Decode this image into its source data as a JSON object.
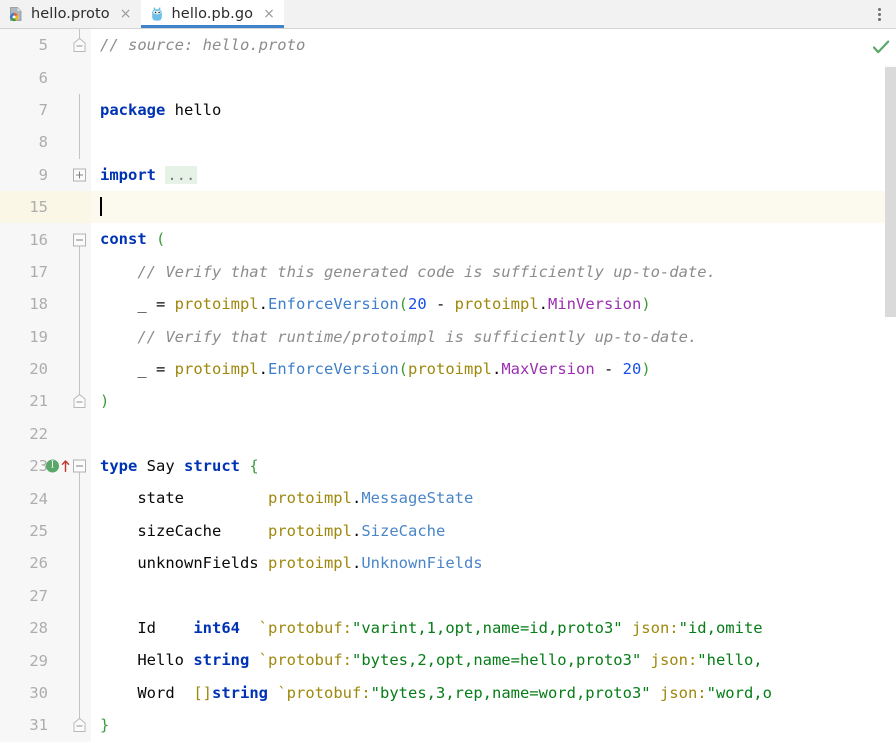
{
  "window": {
    "kebab_menu_label": "More options"
  },
  "tabs": [
    {
      "label": "hello.proto",
      "icon": "protobuf-file-icon",
      "close": "×",
      "active": false
    },
    {
      "label": "hello.pb.go",
      "icon": "go-file-icon",
      "close": "×",
      "active": true
    }
  ],
  "editor": {
    "language": "Go",
    "current_line": 15,
    "status_icon": "inspection-ok-checkmark",
    "colors": {
      "keyword": "#0033b3",
      "comment": "#8c8c8c",
      "string": "#067d17",
      "number": "#1750eb",
      "package": "#9e880d",
      "type": "#4a86c8",
      "constant": "#9b30b0",
      "bracket_green": "#3c9a3c",
      "current_line_bg": "#fcfaef",
      "tab_accent": "#4083c9",
      "gutter_bg": "#f7f7f7"
    },
    "lines": [
      {
        "number": "5",
        "fold": "end",
        "text": "// source: hello.proto",
        "tokens": [
          {
            "t": "// source: hello.proto",
            "c": "cmt"
          }
        ]
      },
      {
        "number": "6",
        "fold": "none",
        "text": "",
        "tokens": []
      },
      {
        "number": "7",
        "fold": "bar",
        "text": "package hello",
        "tokens": [
          {
            "t": "package",
            "c": "kw"
          },
          {
            "t": " hello",
            "c": "plain"
          }
        ]
      },
      {
        "number": "8",
        "fold": "bar",
        "text": "",
        "tokens": []
      },
      {
        "number": "9",
        "fold": "plus",
        "text": "import ...",
        "tokens": [
          {
            "t": "import",
            "c": "kw"
          },
          {
            "t": " ",
            "c": "plain"
          },
          {
            "t": "...",
            "c": "folded"
          }
        ]
      },
      {
        "number": "15",
        "fold": "none",
        "current": true,
        "text": "",
        "tokens": [
          {
            "t": "",
            "c": "caret"
          }
        ]
      },
      {
        "number": "16",
        "fold": "minus",
        "text": "const (",
        "tokens": [
          {
            "t": "const",
            "c": "kw"
          },
          {
            "t": " ",
            "c": "plain"
          },
          {
            "t": "(",
            "c": "br-g"
          }
        ]
      },
      {
        "number": "17",
        "fold": "bar",
        "text": "    // Verify that this generated code is sufficiently up-to-date.",
        "tokens": [
          {
            "t": "    ",
            "c": "plain"
          },
          {
            "t": "// Verify that this generated code is sufficiently up-to-date.",
            "c": "cmt"
          }
        ]
      },
      {
        "number": "18",
        "fold": "bar",
        "text": "    _ = protoimpl.EnforceVersion(20 - protoimpl.MinVersion)",
        "tokens": [
          {
            "t": "    _ = ",
            "c": "plain"
          },
          {
            "t": "protoimpl",
            "c": "pkg"
          },
          {
            "t": ".",
            "c": "plain"
          },
          {
            "t": "EnforceVersion",
            "c": "fn"
          },
          {
            "t": "(",
            "c": "br-g"
          },
          {
            "t": "20",
            "c": "num"
          },
          {
            "t": " - ",
            "c": "plain"
          },
          {
            "t": "protoimpl",
            "c": "pkg"
          },
          {
            "t": ".",
            "c": "plain"
          },
          {
            "t": "MinVersion",
            "c": "const"
          },
          {
            "t": ")",
            "c": "br-g"
          }
        ]
      },
      {
        "number": "19",
        "fold": "bar",
        "text": "    // Verify that runtime/protoimpl is sufficiently up-to-date.",
        "tokens": [
          {
            "t": "    ",
            "c": "plain"
          },
          {
            "t": "// Verify that runtime/protoimpl is sufficiently up-to-date.",
            "c": "cmt"
          }
        ]
      },
      {
        "number": "20",
        "fold": "bar",
        "text": "    _ = protoimpl.EnforceVersion(protoimpl.MaxVersion - 20)",
        "tokens": [
          {
            "t": "    _ = ",
            "c": "plain"
          },
          {
            "t": "protoimpl",
            "c": "pkg"
          },
          {
            "t": ".",
            "c": "plain"
          },
          {
            "t": "EnforceVersion",
            "c": "fn"
          },
          {
            "t": "(",
            "c": "br-g"
          },
          {
            "t": "protoimpl",
            "c": "pkg"
          },
          {
            "t": ".",
            "c": "plain"
          },
          {
            "t": "MaxVersion",
            "c": "const"
          },
          {
            "t": " - ",
            "c": "plain"
          },
          {
            "t": "20",
            "c": "num"
          },
          {
            "t": ")",
            "c": "br-g"
          }
        ]
      },
      {
        "number": "21",
        "fold": "end",
        "text": ")",
        "tokens": [
          {
            "t": ")",
            "c": "br-g"
          }
        ]
      },
      {
        "number": "22",
        "fold": "none",
        "text": "",
        "tokens": []
      },
      {
        "number": "23",
        "fold": "minus",
        "gutter_icons": [
          "implements-interface-icon",
          "overrides-arrow-icon"
        ],
        "text": "type Say struct {",
        "tokens": [
          {
            "t": "type",
            "c": "kw"
          },
          {
            "t": " Say ",
            "c": "plain"
          },
          {
            "t": "struct",
            "c": "kw"
          },
          {
            "t": " ",
            "c": "plain"
          },
          {
            "t": "{",
            "c": "br-g"
          }
        ]
      },
      {
        "number": "24",
        "fold": "bar",
        "text": "    state         protoimpl.MessageState",
        "tokens": [
          {
            "t": "    state         ",
            "c": "plain"
          },
          {
            "t": "protoimpl",
            "c": "pkg"
          },
          {
            "t": ".",
            "c": "plain"
          },
          {
            "t": "MessageState",
            "c": "typ"
          }
        ]
      },
      {
        "number": "25",
        "fold": "bar",
        "text": "    sizeCache     protoimpl.SizeCache",
        "tokens": [
          {
            "t": "    sizeCache     ",
            "c": "plain"
          },
          {
            "t": "protoimpl",
            "c": "pkg"
          },
          {
            "t": ".",
            "c": "plain"
          },
          {
            "t": "SizeCache",
            "c": "typ"
          }
        ]
      },
      {
        "number": "26",
        "fold": "bar",
        "text": "    unknownFields protoimpl.UnknownFields",
        "tokens": [
          {
            "t": "    unknownFields ",
            "c": "plain"
          },
          {
            "t": "protoimpl",
            "c": "pkg"
          },
          {
            "t": ".",
            "c": "plain"
          },
          {
            "t": "UnknownFields",
            "c": "typ"
          }
        ]
      },
      {
        "number": "27",
        "fold": "bar",
        "text": "",
        "tokens": []
      },
      {
        "number": "28",
        "fold": "bar",
        "text": "    Id    int64  `protobuf:\"varint,1,opt,name=id,proto3\" json:\"id,omite",
        "tokens": [
          {
            "t": "    Id    ",
            "c": "plain"
          },
          {
            "t": "int64",
            "c": "kw"
          },
          {
            "t": "  ",
            "c": "plain"
          },
          {
            "t": "`protobuf:",
            "c": "tag"
          },
          {
            "t": "\"varint,1,opt,name=id,proto3\"",
            "c": "str"
          },
          {
            "t": " json:",
            "c": "tag"
          },
          {
            "t": "\"id,omite",
            "c": "str"
          }
        ]
      },
      {
        "number": "29",
        "fold": "bar",
        "text": "    Hello string `protobuf:\"bytes,2,opt,name=hello,proto3\" json:\"hello,",
        "tokens": [
          {
            "t": "    Hello ",
            "c": "plain"
          },
          {
            "t": "string",
            "c": "kw"
          },
          {
            "t": " ",
            "c": "plain"
          },
          {
            "t": "`protobuf:",
            "c": "tag"
          },
          {
            "t": "\"bytes,2,opt,name=hello,proto3\"",
            "c": "str"
          },
          {
            "t": " json:",
            "c": "tag"
          },
          {
            "t": "\"hello,",
            "c": "str"
          }
        ]
      },
      {
        "number": "30",
        "fold": "bar",
        "text": "    Word  []string `protobuf:\"bytes,3,rep,name=word,proto3\" json:\"word,o",
        "tokens": [
          {
            "t": "    Word  ",
            "c": "plain"
          },
          {
            "t": "[]",
            "c": "br-y"
          },
          {
            "t": "string",
            "c": "kw"
          },
          {
            "t": " ",
            "c": "plain"
          },
          {
            "t": "`protobuf:",
            "c": "tag"
          },
          {
            "t": "\"bytes,3,rep,name=word,proto3\"",
            "c": "str"
          },
          {
            "t": " json:",
            "c": "tag"
          },
          {
            "t": "\"word,o",
            "c": "str"
          }
        ]
      },
      {
        "number": "31",
        "fold": "end",
        "text": "}",
        "tokens": [
          {
            "t": "}",
            "c": "br-g"
          }
        ]
      }
    ]
  }
}
